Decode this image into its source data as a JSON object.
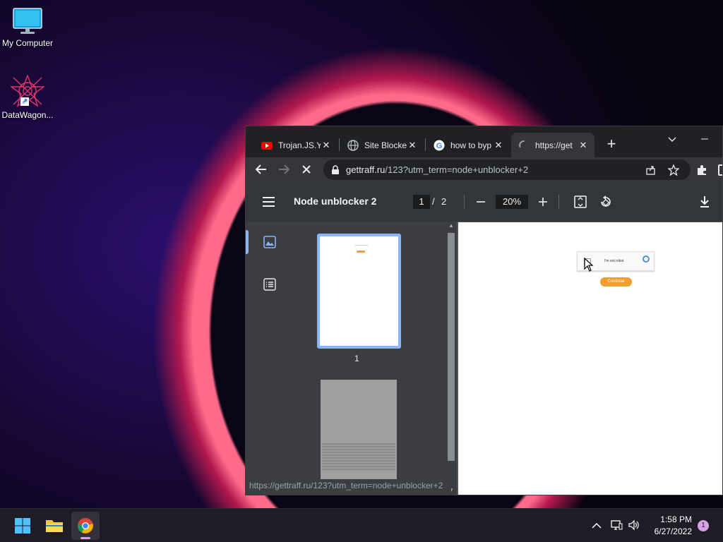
{
  "desktop": {
    "icons": [
      {
        "label": "My Computer",
        "icon": "monitor-icon"
      },
      {
        "label": "DataWagon...",
        "icon": "datawagon-icon"
      }
    ]
  },
  "browser": {
    "tabs": [
      {
        "label": "Trojan.JS.Yo",
        "icon": "youtube-icon",
        "active": false
      },
      {
        "label": "Site Blocker",
        "icon": "globe-icon",
        "active": false
      },
      {
        "label": "how to byp",
        "icon": "google-icon",
        "active": false
      },
      {
        "label": "https://get",
        "icon": "loading-spinner-icon",
        "active": true
      }
    ],
    "new_tab_label": "+",
    "url_host": "gettraff.ru",
    "url_path": "/123?utm_term=node+unblocker+2",
    "pdf": {
      "title": "Node unblocker 2",
      "page_current": "1",
      "page_separator": "/",
      "page_total": "2",
      "zoom": "20%",
      "thumbnail_label": "1"
    },
    "page_content": {
      "captcha_text": "I'm not robot",
      "continue_label": "Continue"
    },
    "status_url": "https://gettraff.ru/123?utm_term=node+unblocker+2"
  },
  "taskbar": {
    "time": "1:58 PM",
    "date": "6/27/2022",
    "notification_count": "1"
  },
  "colors": {
    "accent": "#8ab4f8",
    "continue_button": "#f0a030",
    "taskbar": "#1f1c26"
  }
}
